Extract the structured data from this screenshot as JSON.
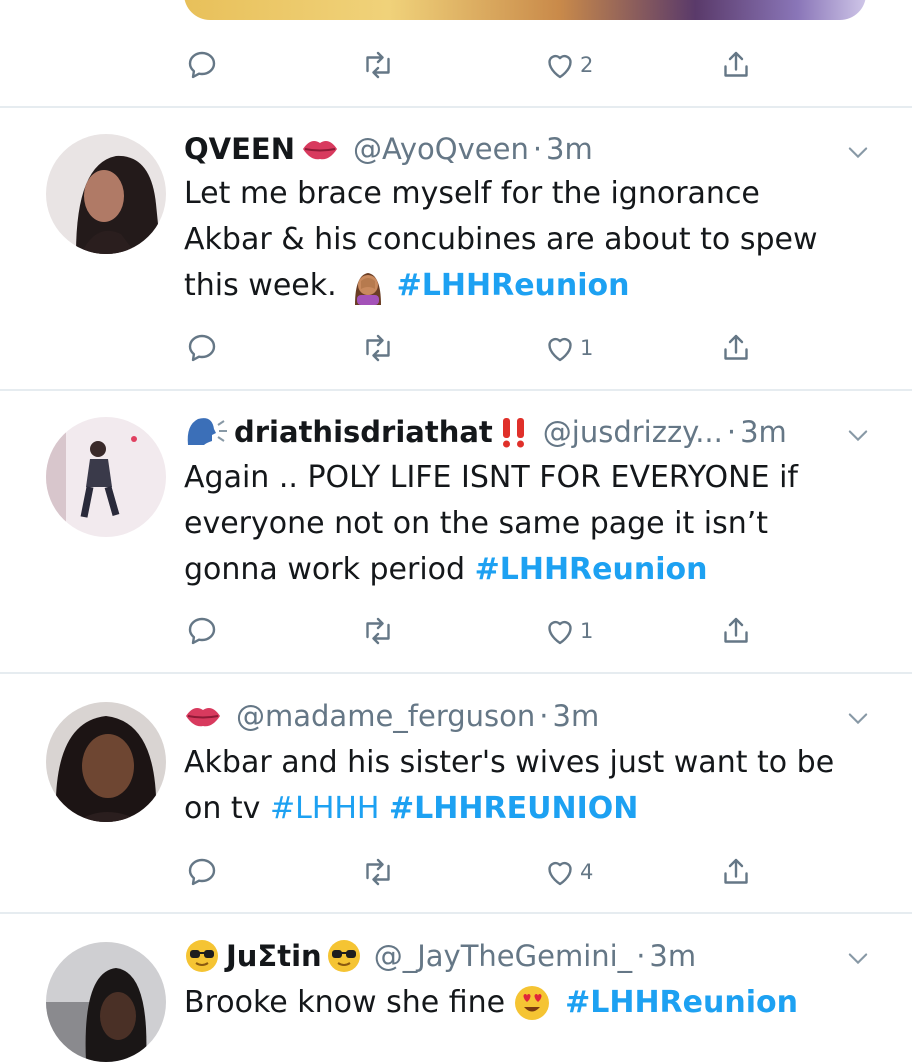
{
  "tweets": [
    {
      "id": "top",
      "likes": "2"
    },
    {
      "id": "t1",
      "name": "QVEEN",
      "handle": "@AyoQveen",
      "time": "3m",
      "lines": [
        "Let me brace myself for the ignorance",
        "Akbar & his concubines are about to spew",
        "this week. "
      ],
      "tag": "#LHHReunion",
      "likes": "1"
    },
    {
      "id": "t2",
      "name": "driathisdriathat",
      "handle": "@jusdrizzy...",
      "time": "3m",
      "lines": [
        "Again .. POLY LIFE ISNT FOR EVERYONE if",
        "everyone not on the same page it isn’t",
        "gonna work period  "
      ],
      "tag": "#LHHReunion",
      "likes": "1"
    },
    {
      "id": "t3",
      "name": "",
      "handle": "@madame_ferguson",
      "time": "3m",
      "lines": [
        "Akbar and his sister's wives just want to be",
        "on tv "
      ],
      "tag1": "#LHHH",
      "tag2": "#LHHREUNION",
      "likes": "4"
    },
    {
      "id": "t4",
      "name": "JuΣtin",
      "handle": "@_JayTheGemini_",
      "time": "3m",
      "lines": [
        "Brooke know she fine "
      ],
      "tag": "#LHHReunion"
    }
  ],
  "dot": "·",
  "colors": {
    "accent": "#1da1f2",
    "secondary": "#657786",
    "divider": "#e6ecf0"
  }
}
